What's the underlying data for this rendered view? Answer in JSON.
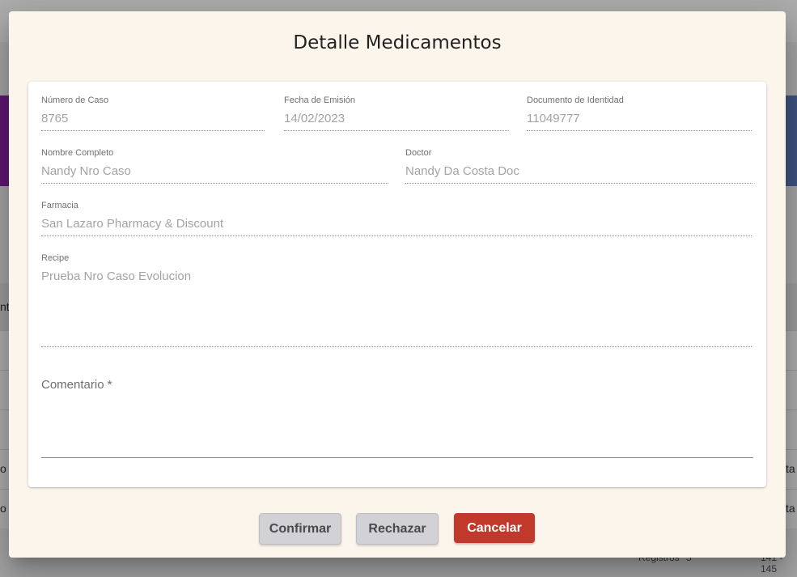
{
  "background": {
    "left_fragments": [
      "nt",
      "o",
      "o"
    ],
    "right_fragments": [
      "ta",
      "ta"
    ],
    "pager_label": "Registros",
    "pager_value": "5",
    "pager_range": "141 - 145"
  },
  "dialog": {
    "title": "Detalle Medicamentos",
    "fields": {
      "numero_caso": {
        "label": "Número de Caso",
        "value": "8765"
      },
      "fecha_emision": {
        "label": "Fecha de Emisión",
        "value": "14/02/2023"
      },
      "documento": {
        "label": "Documento de Identidad",
        "value": "11049777"
      },
      "nombre": {
        "label": "Nombre Completo",
        "value": "Nandy Nro Caso"
      },
      "doctor": {
        "label": "Doctor",
        "value": "Nandy Da Costa Doc"
      },
      "farmacia": {
        "label": "Farmacia",
        "value": "San Lazaro Pharmacy & Discount"
      },
      "recipe": {
        "label": "Recipe",
        "value": "Prueba Nro Caso Evolucion"
      }
    },
    "comentario": {
      "label": "Comentario *",
      "value": ""
    },
    "buttons": {
      "confirmar": "Confirmar",
      "rechazar": "Rechazar",
      "cancelar": "Cancelar"
    },
    "colors": {
      "dialog_bg": "#fcf5ec",
      "cancel_bg": "#c0392b",
      "secondary_bg": "#d1d1d6"
    }
  }
}
